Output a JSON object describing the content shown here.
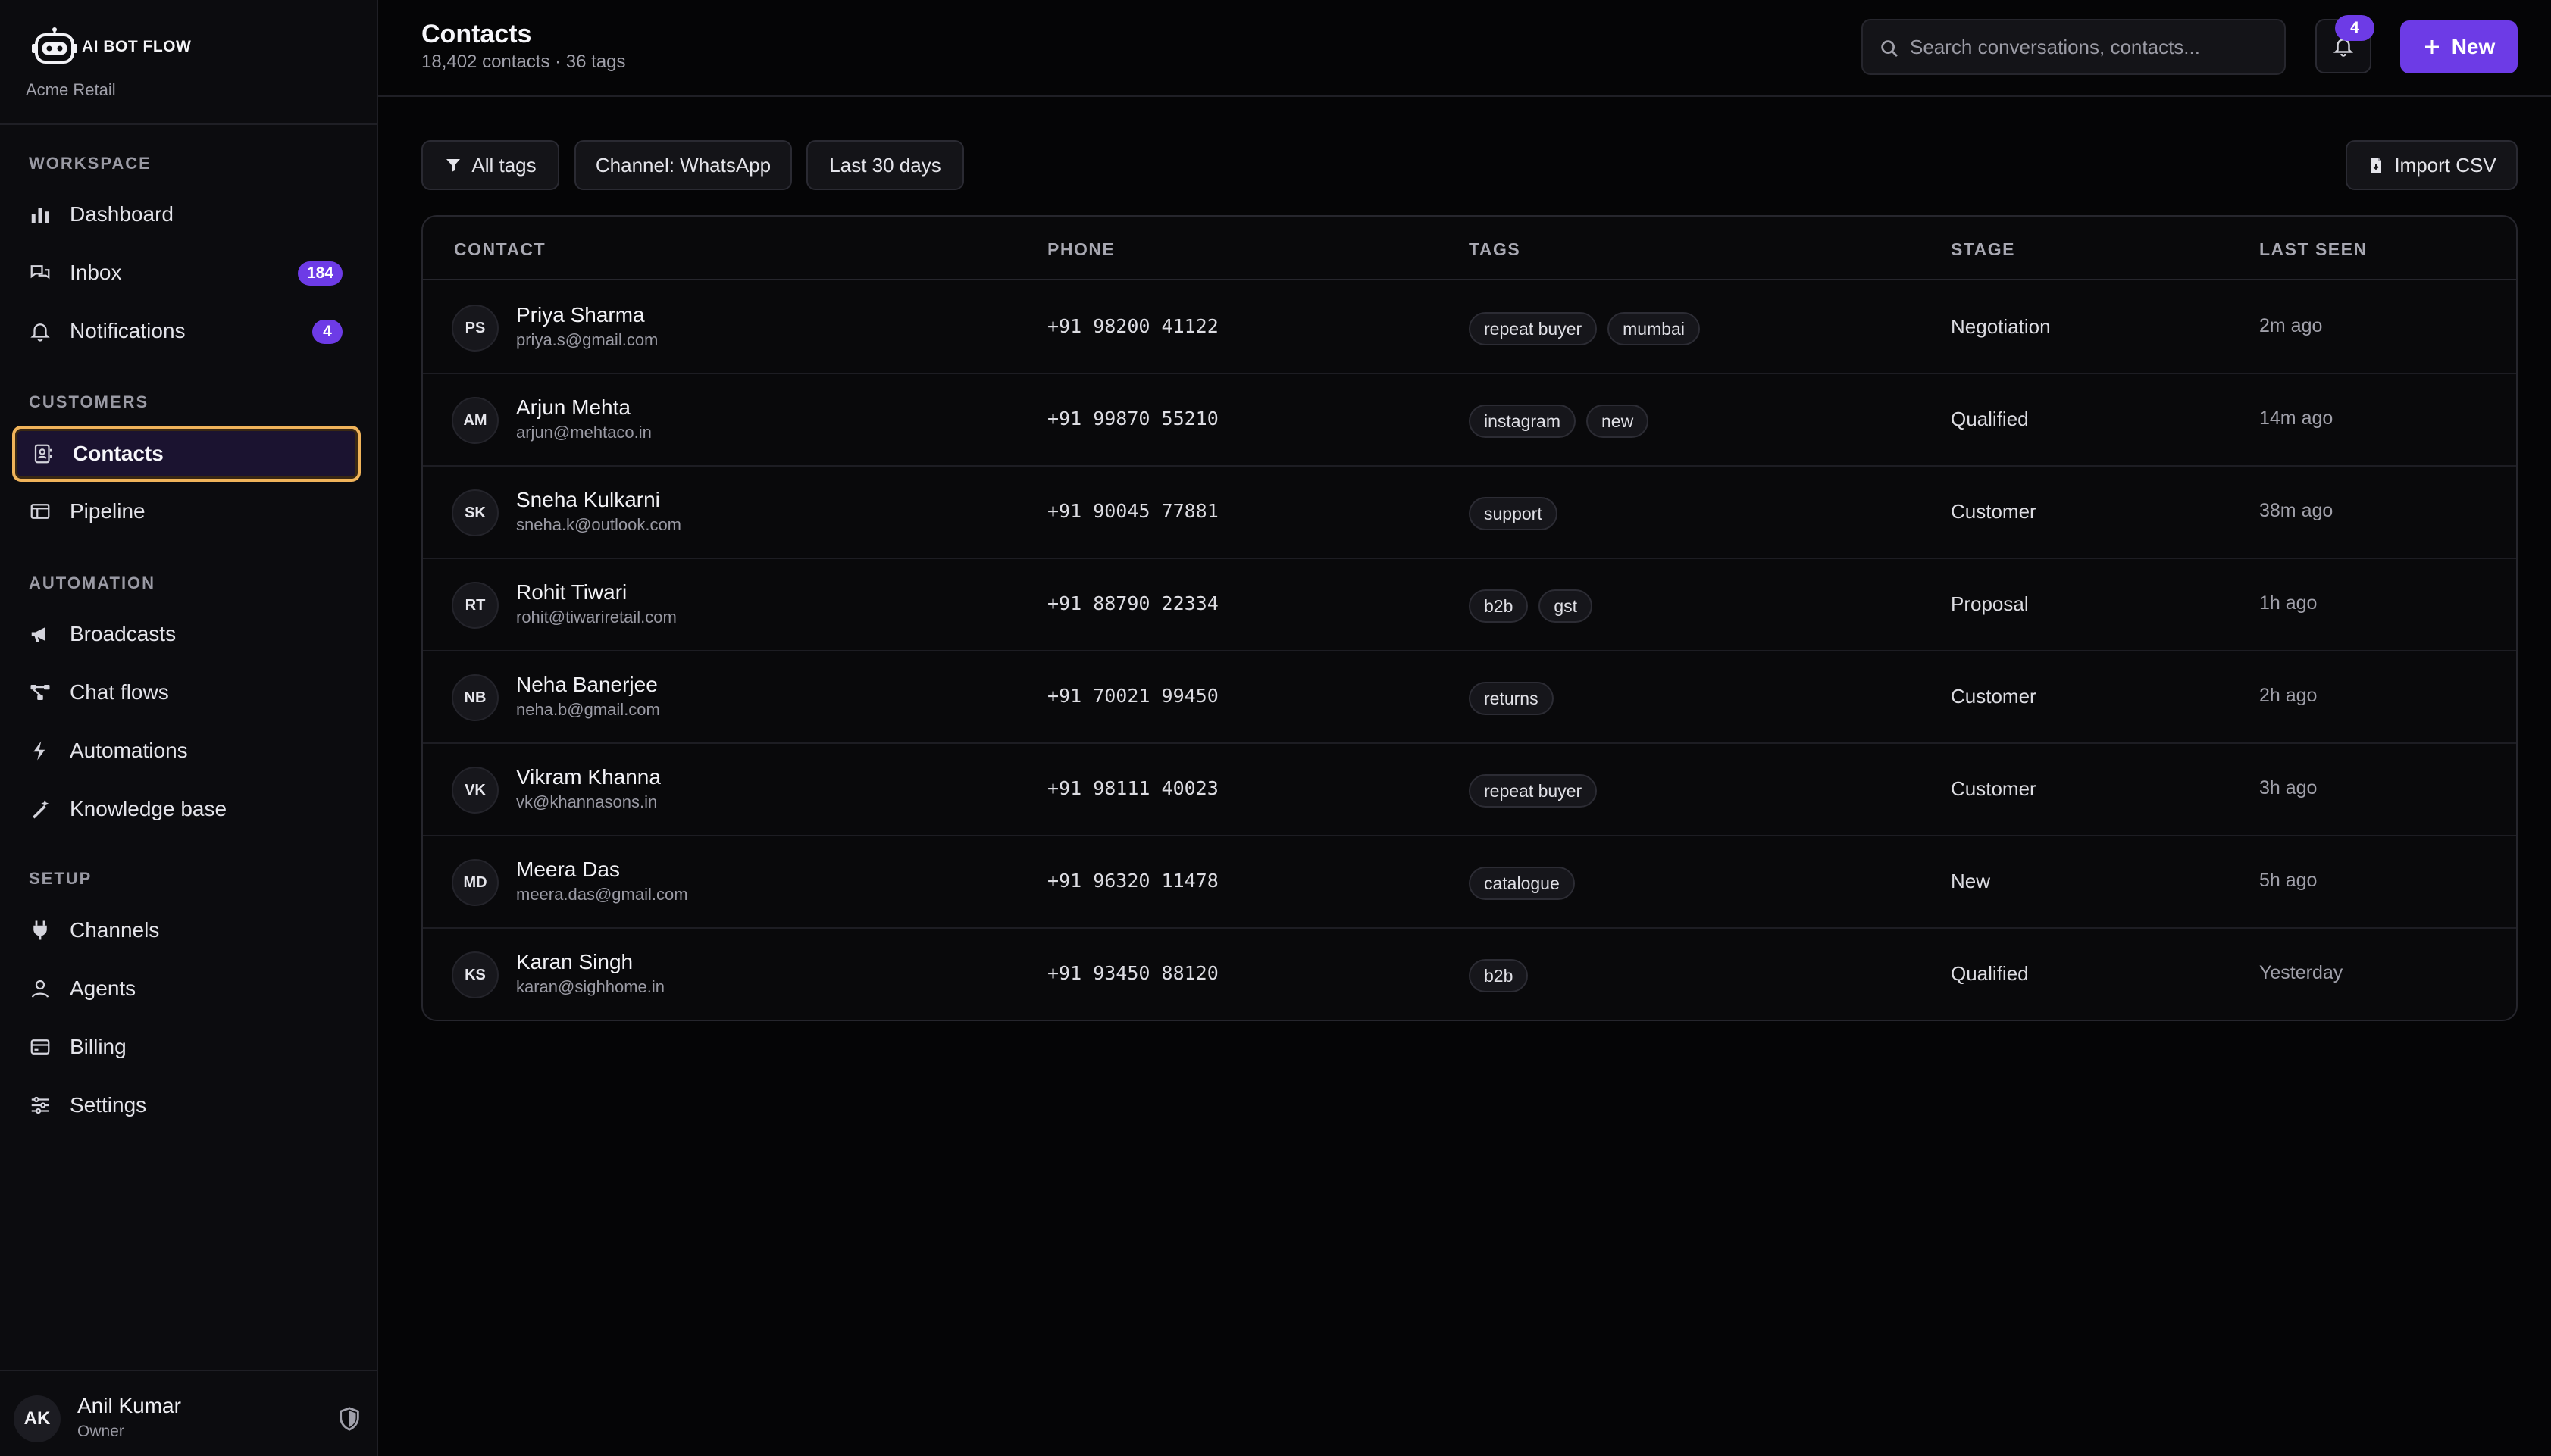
{
  "brand": {
    "name": "AI BOT FLOW",
    "org": "Acme Retail"
  },
  "sidebar": {
    "sections": [
      "WORKSPACE",
      "CUSTOMERS",
      "AUTOMATION",
      "SETUP"
    ],
    "items": [
      {
        "label": "Dashboard",
        "icon": "bar-chart-icon"
      },
      {
        "label": "Inbox",
        "icon": "chat-bubbles-icon",
        "badge": "184"
      },
      {
        "label": "Notifications",
        "icon": "bell-icon",
        "badge": "4"
      },
      {
        "label": "Contacts",
        "icon": "contact-card-icon",
        "active": true
      },
      {
        "label": "Pipeline",
        "icon": "pipeline-board-icon"
      },
      {
        "label": "Broadcasts",
        "icon": "megaphone-icon"
      },
      {
        "label": "Chat flows",
        "icon": "flow-nodes-icon"
      },
      {
        "label": "Automations",
        "icon": "lightning-icon"
      },
      {
        "label": "Knowledge base",
        "icon": "magic-wand-icon"
      },
      {
        "label": "Channels",
        "icon": "plug-icon"
      },
      {
        "label": "Agents",
        "icon": "user-icon"
      },
      {
        "label": "Billing",
        "icon": "credit-card-icon"
      },
      {
        "label": "Settings",
        "icon": "sliders-icon"
      }
    ]
  },
  "user": {
    "initials": "AK",
    "name": "Anil Kumar",
    "role": "Owner"
  },
  "header": {
    "title": "Contacts",
    "subtitle": "18,402 contacts · 36 tags",
    "search_placeholder": "Search conversations, contacts...",
    "notif_count": "4",
    "new_label": "New"
  },
  "filters": {
    "tags": "All tags",
    "channel": "Channel: WhatsApp",
    "range": "Last 30 days",
    "import": "Import CSV"
  },
  "table": {
    "columns": [
      "CONTACT",
      "PHONE",
      "TAGS",
      "STAGE",
      "LAST SEEN"
    ],
    "rows": [
      {
        "initials": "PS",
        "name": "Priya Sharma",
        "email": "priya.s@gmail.com",
        "phone": "+91 98200 41122",
        "tags": [
          "repeat buyer",
          "mumbai"
        ],
        "stage": "Negotiation",
        "seen": "2m ago"
      },
      {
        "initials": "AM",
        "name": "Arjun Mehta",
        "email": "arjun@mehtaco.in",
        "phone": "+91 99870 55210",
        "tags": [
          "instagram",
          "new"
        ],
        "stage": "Qualified",
        "seen": "14m ago"
      },
      {
        "initials": "SK",
        "name": "Sneha Kulkarni",
        "email": "sneha.k@outlook.com",
        "phone": "+91 90045 77881",
        "tags": [
          "support"
        ],
        "stage": "Customer",
        "seen": "38m ago"
      },
      {
        "initials": "RT",
        "name": "Rohit Tiwari",
        "email": "rohit@tiwariretail.com",
        "phone": "+91 88790 22334",
        "tags": [
          "b2b",
          "gst"
        ],
        "stage": "Proposal",
        "seen": "1h ago"
      },
      {
        "initials": "NB",
        "name": "Neha Banerjee",
        "email": "neha.b@gmail.com",
        "phone": "+91 70021 99450",
        "tags": [
          "returns"
        ],
        "stage": "Customer",
        "seen": "2h ago"
      },
      {
        "initials": "VK",
        "name": "Vikram Khanna",
        "email": "vk@khannasons.in",
        "phone": "+91 98111 40023",
        "tags": [
          "repeat buyer"
        ],
        "stage": "Customer",
        "seen": "3h ago"
      },
      {
        "initials": "MD",
        "name": "Meera Das",
        "email": "meera.das@gmail.com",
        "phone": "+91 96320 11478",
        "tags": [
          "catalogue"
        ],
        "stage": "New",
        "seen": "5h ago"
      },
      {
        "initials": "KS",
        "name": "Karan Singh",
        "email": "karan@sighhome.in",
        "phone": "+91 93450 88120",
        "tags": [
          "b2b"
        ],
        "stage": "Qualified",
        "seen": "Yesterday"
      }
    ]
  },
  "colors": {
    "accent": "#6d3be6",
    "active_outline": "#f0b35a",
    "background": "#050506"
  }
}
